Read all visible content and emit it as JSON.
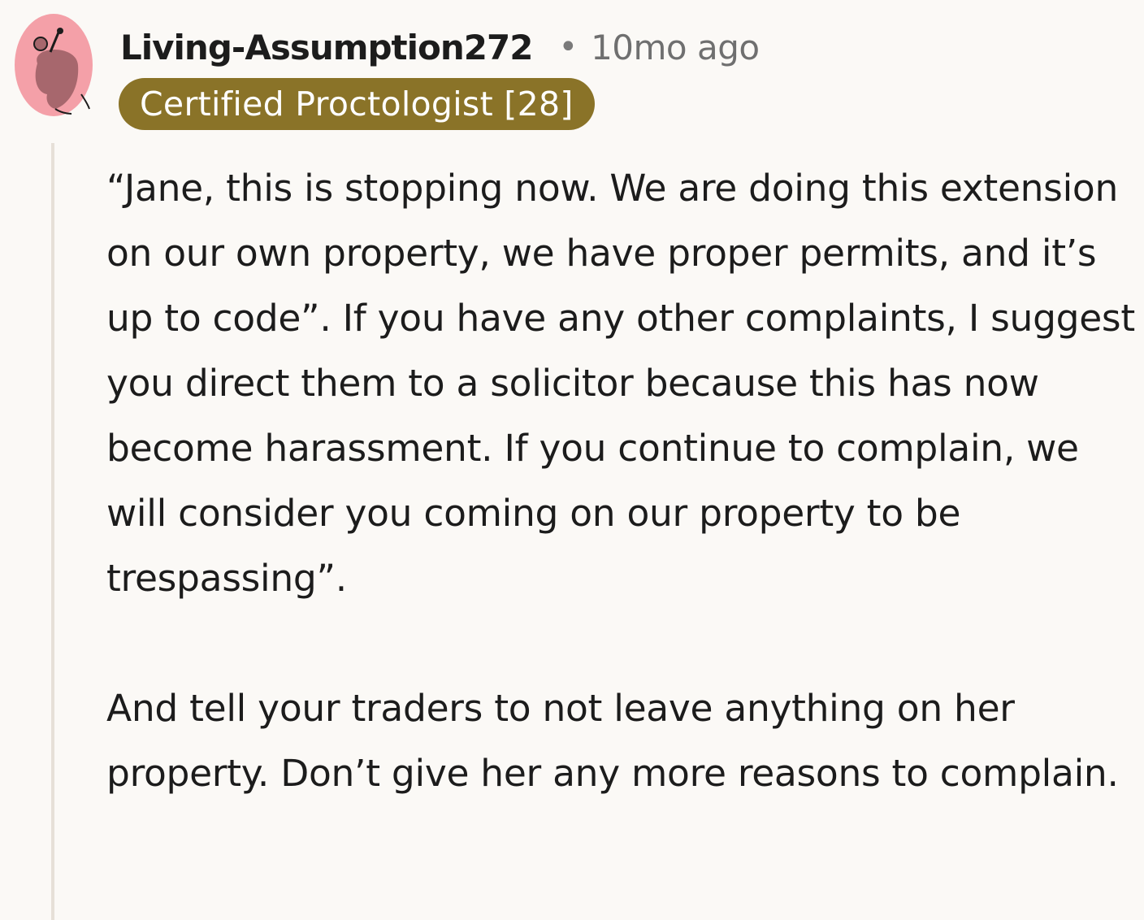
{
  "comment": {
    "author": "Living-Assumption272",
    "separator": "•",
    "timestamp": "10mo ago",
    "flair": "Certified Proctologist [28]",
    "avatar_icon": "snoo-avatar-icon",
    "colors": {
      "flair_bg": "#8a7328",
      "avatar_bg": "#f4a0a8",
      "background": "#fbf9f6"
    },
    "paragraphs": [
      "“Jane, this is stopping now. We are doing this extension on our own property, we have proper permits, and it’s up to code”. If you have any other complaints, I suggest you direct them to a solicitor because this has now become harassment. If you continue to complain, we will consider you coming on our property to be trespassing”.",
      "And tell your traders to not leave anything on her property. Don’t give her any more reasons to complain."
    ]
  }
}
